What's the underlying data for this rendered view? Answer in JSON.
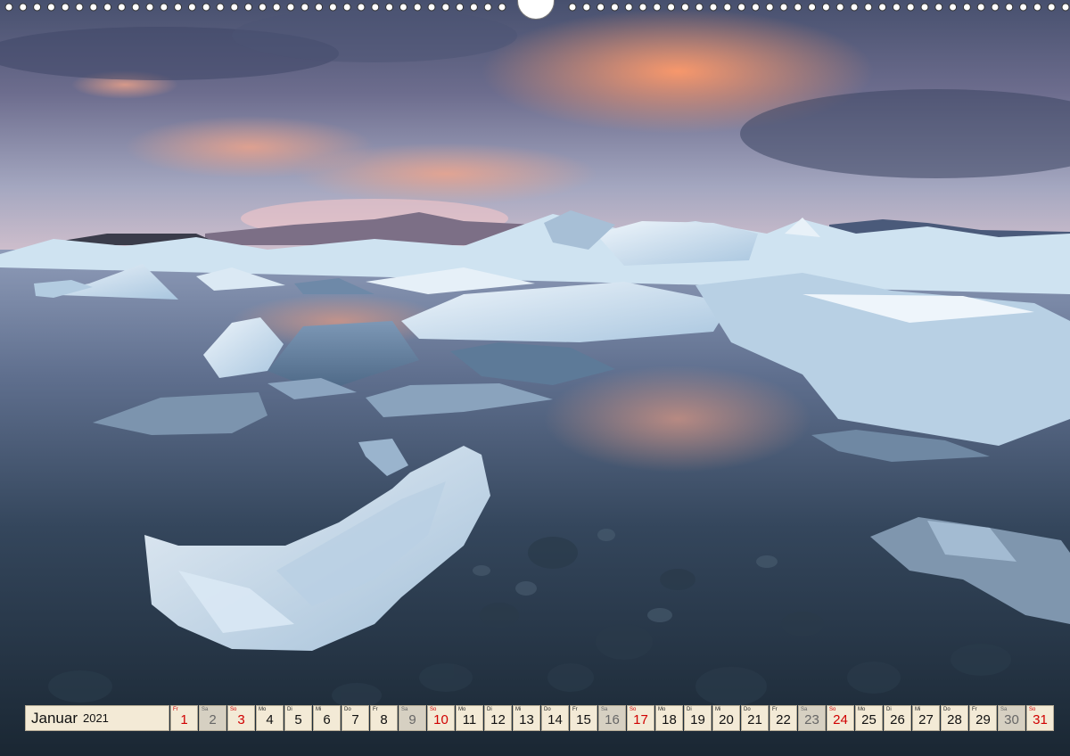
{
  "calendar": {
    "month": "Januar",
    "year": "2021",
    "days": [
      {
        "wd": "Fr",
        "num": "1",
        "type": "holiday"
      },
      {
        "wd": "Sa",
        "num": "2",
        "type": "sat"
      },
      {
        "wd": "So",
        "num": "3",
        "type": "sun"
      },
      {
        "wd": "Mo",
        "num": "4",
        "type": "week"
      },
      {
        "wd": "Di",
        "num": "5",
        "type": "week"
      },
      {
        "wd": "Mi",
        "num": "6",
        "type": "week"
      },
      {
        "wd": "Do",
        "num": "7",
        "type": "week"
      },
      {
        "wd": "Fr",
        "num": "8",
        "type": "week"
      },
      {
        "wd": "Sa",
        "num": "9",
        "type": "sat"
      },
      {
        "wd": "So",
        "num": "10",
        "type": "sun"
      },
      {
        "wd": "Mo",
        "num": "11",
        "type": "week"
      },
      {
        "wd": "Di",
        "num": "12",
        "type": "week"
      },
      {
        "wd": "Mi",
        "num": "13",
        "type": "week"
      },
      {
        "wd": "Do",
        "num": "14",
        "type": "week"
      },
      {
        "wd": "Fr",
        "num": "15",
        "type": "week"
      },
      {
        "wd": "Sa",
        "num": "16",
        "type": "sat"
      },
      {
        "wd": "So",
        "num": "17",
        "type": "sun"
      },
      {
        "wd": "Mo",
        "num": "18",
        "type": "week"
      },
      {
        "wd": "Di",
        "num": "19",
        "type": "week"
      },
      {
        "wd": "Mi",
        "num": "20",
        "type": "week"
      },
      {
        "wd": "Do",
        "num": "21",
        "type": "week"
      },
      {
        "wd": "Fr",
        "num": "22",
        "type": "week"
      },
      {
        "wd": "Sa",
        "num": "23",
        "type": "sat"
      },
      {
        "wd": "So",
        "num": "24",
        "type": "sun"
      },
      {
        "wd": "Mo",
        "num": "25",
        "type": "week"
      },
      {
        "wd": "Di",
        "num": "26",
        "type": "week"
      },
      {
        "wd": "Mi",
        "num": "27",
        "type": "week"
      },
      {
        "wd": "Do",
        "num": "28",
        "type": "week"
      },
      {
        "wd": "Fr",
        "num": "29",
        "type": "week"
      },
      {
        "wd": "Sa",
        "num": "30",
        "type": "sat"
      },
      {
        "wd": "So",
        "num": "31",
        "type": "sun"
      }
    ]
  },
  "colors": {
    "sunday": "#d00000",
    "saturday_bg": "#d6d0c2",
    "day_bg": "#f3ead6"
  }
}
